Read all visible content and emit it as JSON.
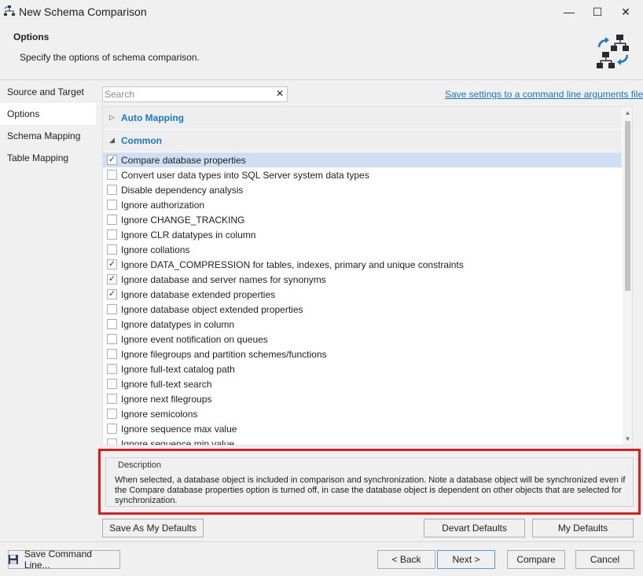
{
  "window": {
    "title": "New Schema Comparison",
    "minimize_glyph": "—",
    "maximize_glyph": "☐",
    "close_glyph": "✕"
  },
  "header": {
    "title": "Options",
    "subtitle": "Specify the options of schema comparison."
  },
  "nav": {
    "items": [
      {
        "label": "Source and Target",
        "active": false
      },
      {
        "label": "Options",
        "active": true
      },
      {
        "label": "Schema Mapping",
        "active": false
      },
      {
        "label": "Table Mapping",
        "active": false
      }
    ]
  },
  "search": {
    "placeholder": "Search",
    "value": "",
    "clear_glyph": "✕"
  },
  "save_settings_link": "Save settings to a command line arguments file...",
  "groups": [
    {
      "label": "Auto Mapping",
      "expanded": false,
      "arrow": "▷"
    },
    {
      "label": "Common",
      "expanded": true,
      "arrow": "◢"
    }
  ],
  "options": [
    {
      "label": "Compare database properties",
      "checked": true,
      "selected": true
    },
    {
      "label": "Convert user data types into SQL Server system data types",
      "checked": false
    },
    {
      "label": "Disable dependency analysis",
      "checked": false
    },
    {
      "label": "Ignore authorization",
      "checked": false
    },
    {
      "label": "Ignore CHANGE_TRACKING",
      "checked": false
    },
    {
      "label": "Ignore CLR datatypes in column",
      "checked": false
    },
    {
      "label": "Ignore collations",
      "checked": false
    },
    {
      "label": "Ignore DATA_COMPRESSION for tables, indexes, primary and unique constraints",
      "checked": true
    },
    {
      "label": "Ignore database and server names for synonyms",
      "checked": true
    },
    {
      "label": "Ignore database extended properties",
      "checked": true
    },
    {
      "label": "Ignore database object extended properties",
      "checked": false
    },
    {
      "label": "Ignore datatypes in column",
      "checked": false
    },
    {
      "label": "Ignore event notification on queues",
      "checked": false
    },
    {
      "label": "Ignore filegroups and partition schemes/functions",
      "checked": false
    },
    {
      "label": "Ignore full-text catalog path",
      "checked": false
    },
    {
      "label": "Ignore full-text search",
      "checked": false
    },
    {
      "label": "Ignore next filegroups",
      "checked": false
    },
    {
      "label": "Ignore semicolons",
      "checked": false
    },
    {
      "label": "Ignore sequence max value",
      "checked": false
    },
    {
      "label": "Ignore sequence min value",
      "checked": false
    }
  ],
  "description": {
    "legend": "Description",
    "text": "When selected, a database object is included in comparison and synchronization. Note a database object will be synchronized even if the Compare database properties option is turned off, in case the database object is dependent on other objects that are selected for synchronization."
  },
  "defaults_buttons": {
    "save_as_my_defaults": "Save As My Defaults",
    "devart_defaults": "Devart Defaults",
    "my_defaults": "My Defaults"
  },
  "footer": {
    "save_command_line": "Save Command Line...",
    "back": "< Back",
    "next": "Next >",
    "compare": "Compare",
    "cancel": "Cancel"
  },
  "colors": {
    "accent": "#1c79c7",
    "highlight": "#e21a1a",
    "selected_row": "#cfe0f5"
  },
  "icons": {
    "app": "schema-compare-icon",
    "header": "schema-compare-large-icon",
    "save": "floppy-disk-icon",
    "check": "✓"
  }
}
